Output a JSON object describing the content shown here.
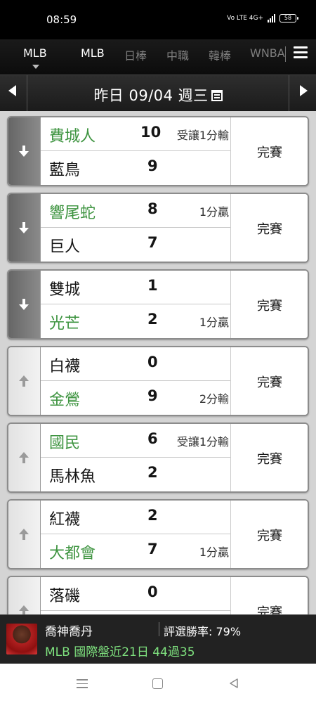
{
  "status_bar": {
    "time": "08:59",
    "network": "Vo LTE 4G+",
    "battery": "58"
  },
  "tabs": [
    {
      "label": "MLB",
      "active": true
    },
    {
      "label": "MLB",
      "active": false
    },
    {
      "label": "日棒",
      "active": false
    },
    {
      "label": "中職",
      "active": false
    },
    {
      "label": "韓棒",
      "active": false
    },
    {
      "label": "WNBA",
      "active": false
    }
  ],
  "date_bar": {
    "label": "昨日 09/04 週三"
  },
  "games": [
    {
      "arrow": "down",
      "top": {
        "name": "費城人",
        "score": "10",
        "note": "受讓1分輸",
        "win": true
      },
      "bottom": {
        "name": "藍鳥",
        "score": "9",
        "note": "",
        "win": false
      },
      "status": "完賽"
    },
    {
      "arrow": "down",
      "top": {
        "name": "響尾蛇",
        "score": "8",
        "note": "1分贏",
        "win": true
      },
      "bottom": {
        "name": "巨人",
        "score": "7",
        "note": "",
        "win": false
      },
      "status": "完賽"
    },
    {
      "arrow": "down",
      "top": {
        "name": "雙城",
        "score": "1",
        "note": "",
        "win": false
      },
      "bottom": {
        "name": "光芒",
        "score": "2",
        "note": "1分贏",
        "win": true
      },
      "status": "完賽"
    },
    {
      "arrow": "up",
      "top": {
        "name": "白襪",
        "score": "0",
        "note": "",
        "win": false
      },
      "bottom": {
        "name": "金鶯",
        "score": "9",
        "note": "2分輸",
        "win": true
      },
      "status": "完賽"
    },
    {
      "arrow": "up",
      "top": {
        "name": "國民",
        "score": "6",
        "note": "受讓1分輸",
        "win": true
      },
      "bottom": {
        "name": "馬林魚",
        "score": "2",
        "note": "",
        "win": false
      },
      "status": "完賽"
    },
    {
      "arrow": "up",
      "top": {
        "name": "紅襪",
        "score": "2",
        "note": "",
        "win": false
      },
      "bottom": {
        "name": "大都會",
        "score": "7",
        "note": "1分贏",
        "win": true
      },
      "status": "完賽"
    },
    {
      "arrow": "up",
      "top": {
        "name": "落磯",
        "score": "0",
        "note": "",
        "win": false
      },
      "bottom": {
        "name": "",
        "score": "",
        "note": "",
        "win": false
      },
      "status": "完賽"
    }
  ],
  "promo": {
    "name": "喬神喬丹",
    "win_rate": "評選勝率: 79%",
    "record": "MLB 國際盤近21日 44過35"
  },
  "colors": {
    "win_green": "#3e9440",
    "promo_green": "#7ee07e"
  }
}
